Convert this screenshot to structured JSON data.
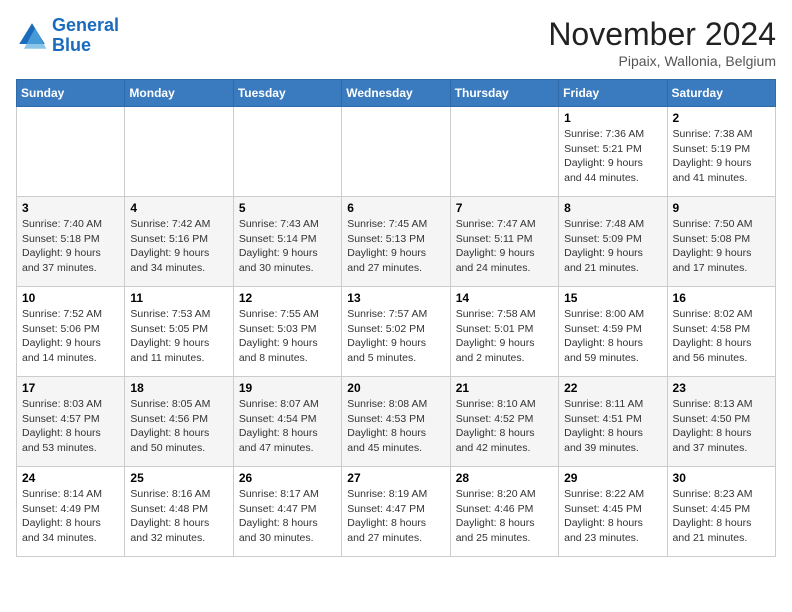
{
  "header": {
    "logo_line1": "General",
    "logo_line2": "Blue",
    "month_title": "November 2024",
    "location": "Pipaix, Wallonia, Belgium"
  },
  "weekdays": [
    "Sunday",
    "Monday",
    "Tuesday",
    "Wednesday",
    "Thursday",
    "Friday",
    "Saturday"
  ],
  "weeks": [
    [
      {
        "day": "",
        "info": ""
      },
      {
        "day": "",
        "info": ""
      },
      {
        "day": "",
        "info": ""
      },
      {
        "day": "",
        "info": ""
      },
      {
        "day": "",
        "info": ""
      },
      {
        "day": "1",
        "info": "Sunrise: 7:36 AM\nSunset: 5:21 PM\nDaylight: 9 hours and 44 minutes."
      },
      {
        "day": "2",
        "info": "Sunrise: 7:38 AM\nSunset: 5:19 PM\nDaylight: 9 hours and 41 minutes."
      }
    ],
    [
      {
        "day": "3",
        "info": "Sunrise: 7:40 AM\nSunset: 5:18 PM\nDaylight: 9 hours and 37 minutes."
      },
      {
        "day": "4",
        "info": "Sunrise: 7:42 AM\nSunset: 5:16 PM\nDaylight: 9 hours and 34 minutes."
      },
      {
        "day": "5",
        "info": "Sunrise: 7:43 AM\nSunset: 5:14 PM\nDaylight: 9 hours and 30 minutes."
      },
      {
        "day": "6",
        "info": "Sunrise: 7:45 AM\nSunset: 5:13 PM\nDaylight: 9 hours and 27 minutes."
      },
      {
        "day": "7",
        "info": "Sunrise: 7:47 AM\nSunset: 5:11 PM\nDaylight: 9 hours and 24 minutes."
      },
      {
        "day": "8",
        "info": "Sunrise: 7:48 AM\nSunset: 5:09 PM\nDaylight: 9 hours and 21 minutes."
      },
      {
        "day": "9",
        "info": "Sunrise: 7:50 AM\nSunset: 5:08 PM\nDaylight: 9 hours and 17 minutes."
      }
    ],
    [
      {
        "day": "10",
        "info": "Sunrise: 7:52 AM\nSunset: 5:06 PM\nDaylight: 9 hours and 14 minutes."
      },
      {
        "day": "11",
        "info": "Sunrise: 7:53 AM\nSunset: 5:05 PM\nDaylight: 9 hours and 11 minutes."
      },
      {
        "day": "12",
        "info": "Sunrise: 7:55 AM\nSunset: 5:03 PM\nDaylight: 9 hours and 8 minutes."
      },
      {
        "day": "13",
        "info": "Sunrise: 7:57 AM\nSunset: 5:02 PM\nDaylight: 9 hours and 5 minutes."
      },
      {
        "day": "14",
        "info": "Sunrise: 7:58 AM\nSunset: 5:01 PM\nDaylight: 9 hours and 2 minutes."
      },
      {
        "day": "15",
        "info": "Sunrise: 8:00 AM\nSunset: 4:59 PM\nDaylight: 8 hours and 59 minutes."
      },
      {
        "day": "16",
        "info": "Sunrise: 8:02 AM\nSunset: 4:58 PM\nDaylight: 8 hours and 56 minutes."
      }
    ],
    [
      {
        "day": "17",
        "info": "Sunrise: 8:03 AM\nSunset: 4:57 PM\nDaylight: 8 hours and 53 minutes."
      },
      {
        "day": "18",
        "info": "Sunrise: 8:05 AM\nSunset: 4:56 PM\nDaylight: 8 hours and 50 minutes."
      },
      {
        "day": "19",
        "info": "Sunrise: 8:07 AM\nSunset: 4:54 PM\nDaylight: 8 hours and 47 minutes."
      },
      {
        "day": "20",
        "info": "Sunrise: 8:08 AM\nSunset: 4:53 PM\nDaylight: 8 hours and 45 minutes."
      },
      {
        "day": "21",
        "info": "Sunrise: 8:10 AM\nSunset: 4:52 PM\nDaylight: 8 hours and 42 minutes."
      },
      {
        "day": "22",
        "info": "Sunrise: 8:11 AM\nSunset: 4:51 PM\nDaylight: 8 hours and 39 minutes."
      },
      {
        "day": "23",
        "info": "Sunrise: 8:13 AM\nSunset: 4:50 PM\nDaylight: 8 hours and 37 minutes."
      }
    ],
    [
      {
        "day": "24",
        "info": "Sunrise: 8:14 AM\nSunset: 4:49 PM\nDaylight: 8 hours and 34 minutes."
      },
      {
        "day": "25",
        "info": "Sunrise: 8:16 AM\nSunset: 4:48 PM\nDaylight: 8 hours and 32 minutes."
      },
      {
        "day": "26",
        "info": "Sunrise: 8:17 AM\nSunset: 4:47 PM\nDaylight: 8 hours and 30 minutes."
      },
      {
        "day": "27",
        "info": "Sunrise: 8:19 AM\nSunset: 4:47 PM\nDaylight: 8 hours and 27 minutes."
      },
      {
        "day": "28",
        "info": "Sunrise: 8:20 AM\nSunset: 4:46 PM\nDaylight: 8 hours and 25 minutes."
      },
      {
        "day": "29",
        "info": "Sunrise: 8:22 AM\nSunset: 4:45 PM\nDaylight: 8 hours and 23 minutes."
      },
      {
        "day": "30",
        "info": "Sunrise: 8:23 AM\nSunset: 4:45 PM\nDaylight: 8 hours and 21 minutes."
      }
    ]
  ]
}
